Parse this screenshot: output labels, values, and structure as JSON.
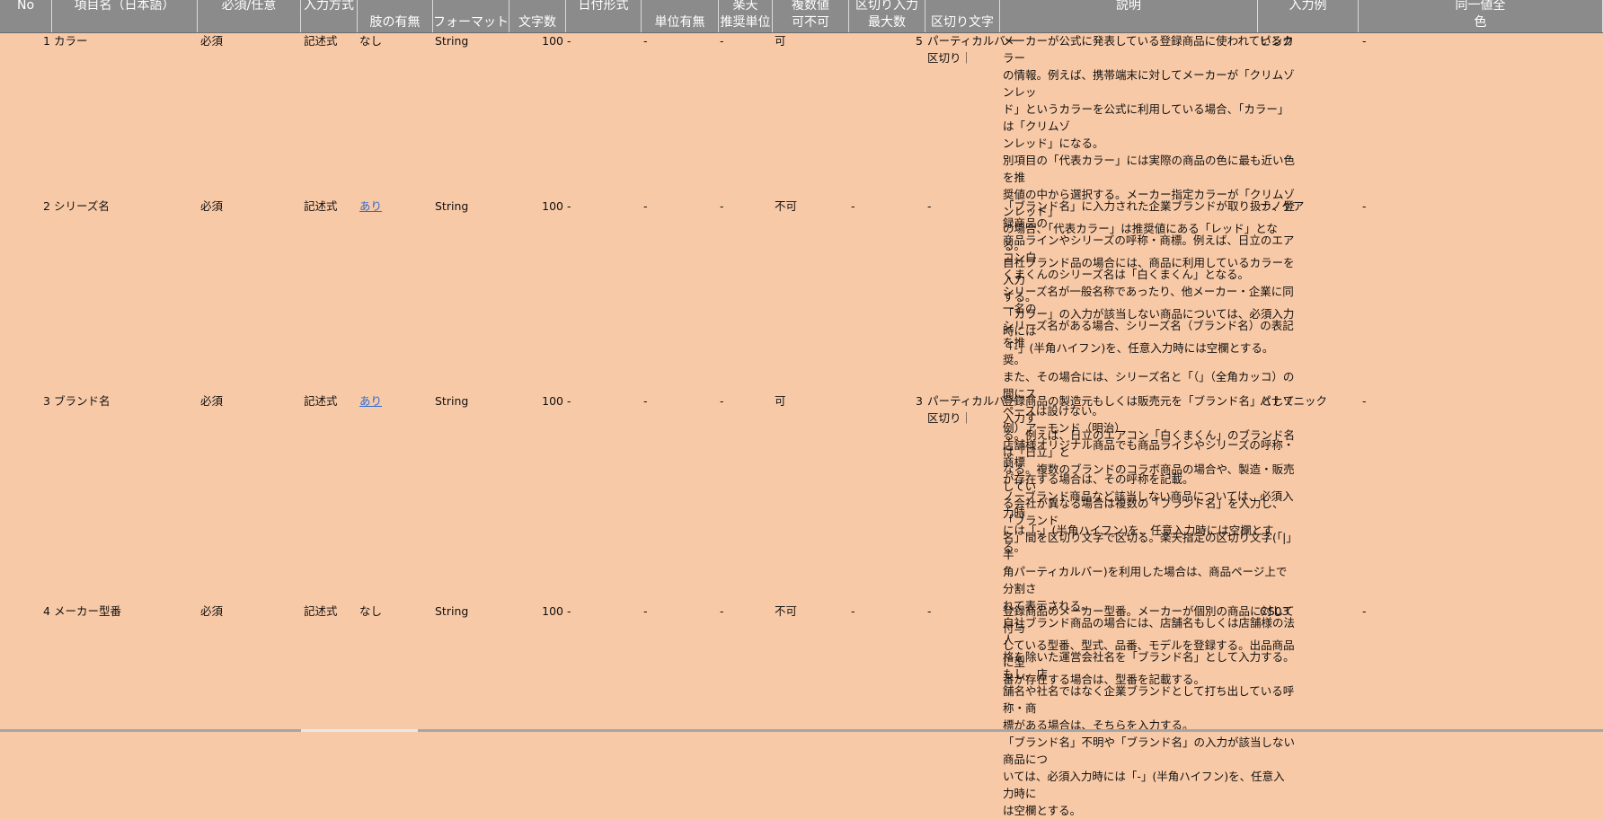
{
  "headers": [
    {
      "l1": "No",
      "l2": ""
    },
    {
      "l1": "項目名（日本語）",
      "l2": ""
    },
    {
      "l1": "必須/任意",
      "l2": ""
    },
    {
      "l1": "入力方式",
      "l2": ""
    },
    {
      "l1": "",
      "l2": "肢の有無"
    },
    {
      "l1": "",
      "l2": "フォーマット"
    },
    {
      "l1": "",
      "l2": "文字数"
    },
    {
      "l1": "日付形式",
      "l2": ""
    },
    {
      "l1": "",
      "l2": "単位有無"
    },
    {
      "l1": "楽天",
      "l2": "推奨単位"
    },
    {
      "l1": "複数値",
      "l2": "可不可"
    },
    {
      "l1": "区切り入力",
      "l2": "最大数"
    },
    {
      "l1": "",
      "l2": "区切り文字"
    },
    {
      "l1": "説明",
      "l2": ""
    },
    {
      "l1": "入力例",
      "l2": ""
    },
    {
      "l1": "同一値全",
      "l2": "色"
    }
  ],
  "rows": [
    {
      "no": "1",
      "name": "カラー",
      "req": "必須",
      "method": "記述式",
      "choice": "なし",
      "format": "String",
      "chars": "100",
      "date": "-",
      "unit": "-",
      "rakuten": "-",
      "multi": "可",
      "max": "5",
      "sep1": "パーティカルバー",
      "sep2": "区切り｜",
      "desc": [
        "メーカーが公式に発表している登録商品に使われているカラー",
        "の情報。例えば、携帯端末に対してメーカーが「クリムゾンレッ",
        "ド」というカラーを公式に利用している場合、「カラー」は「クリムゾ",
        "ンレッド」になる。",
        "別項目の「代表カラー」には実際の商品の色に最も近い色を推",
        "奨値の中から選択する。メーカー指定カラーが「クリムゾンレッド」",
        "の場合、「代表カラー」は推奨値にある「レッド」となる。",
        "自社ブランド品の場合には、商品に利用しているカラーを入力",
        "する。",
        "「カラー」の入力が該当しない商品については、必須入力時には",
        "「-」(半角ハイフン)を、任意入力時には空欄とする。"
      ],
      "example": "ピンク",
      "same": "-"
    },
    {
      "no": "2",
      "name": "シリーズ名",
      "req": "必須",
      "method": "記述式",
      "choice": "あり",
      "format": "String",
      "chars": "100",
      "date": "-",
      "unit": "-",
      "rakuten": "-",
      "multi": "不可",
      "max": "-",
      "sep1": "-",
      "sep2": "",
      "desc": [
        "「ブランド名」に入力された企業ブランドが取り扱う、登録商品の",
        "商品ラインやシリーズの呼称・商標。例えば、日立のエアコン白",
        "くまくんのシリーズ名は「白くまくん」となる。",
        "シリーズ名が一般名称であったり、他メーカー・企業に同一名の",
        "シリーズ名がある場合、シリーズ名（ブランド名）の表記を推",
        "奨。",
        "また、その場合には、シリーズ名と「（」（全角カッコ）の間にス",
        "ペースは設けない。",
        "例）アーモンド（明治）",
        "店舗様オリジナル商品でも商品ラインやシリーズの呼称・商標",
        "が存在する場合は、その呼称を記載。",
        "ノーブランド商品など該当しない商品については、必須入力時",
        "には「-」(半角ハイフン)を、任意入力時には空欄とする。"
      ],
      "example": "ナノケア",
      "same": "-"
    },
    {
      "no": "3",
      "name": "ブランド名",
      "req": "必須",
      "method": "記述式",
      "choice": "あり",
      "format": "String",
      "chars": "100",
      "date": "-",
      "unit": "-",
      "rakuten": "-",
      "multi": "可",
      "max": "3",
      "sep1": "パーティカルバー",
      "sep2": "区切り｜",
      "desc": [
        "登録商品の製造元もしくは販売元を「ブランド名」として入力す",
        "る。例えば、日立のエアコン「白くまくん」のブランド名は「日立」と",
        "なる。複数のブランドのコラボ商品の場合や、製造・販売してい",
        "る会社が異なる場合は複数の「ブランド名」を入力し、「ブランド",
        "名」間を区切り文字で区切る。楽天指定の区切り文字(「|」半",
        "角パーティカルバー)を利用した場合は、商品ページ上で分割さ",
        "れて表示される。",
        "自社ブランド商品の場合には、店舗名もしくは店舗様の法人",
        "格を除いた運営会社名を「ブランド名」として入力する。もし、店",
        "舗名や社名ではなく企業ブランドとして打ち出している呼称・商",
        "標がある場合は、そちらを入力する。",
        "「ブランド名」不明や「ブランド名」の入力が該当しない商品につ",
        "いては、必須入力時には「-」(半角ハイフン)を、任意入力時に",
        "は空欄とする。"
      ],
      "example": "パナソニック",
      "same": "-"
    },
    {
      "no": "4",
      "name": "メーカー型番",
      "req": "必須",
      "method": "記述式",
      "choice": "なし",
      "format": "String",
      "chars": "100",
      "date": "-",
      "unit": "-",
      "rakuten": "-",
      "multi": "不可",
      "max": "-",
      "sep1": "-",
      "sep2": "",
      "desc": [
        "登録商品のメーカー型番。メーカーが個別の商品に対して付与",
        "している型番、型式、品番、モデルを登録する。出品商品に型",
        "番が存在する場合は、型番を記載する。"
      ],
      "example": "CS03",
      "same": "-"
    }
  ]
}
